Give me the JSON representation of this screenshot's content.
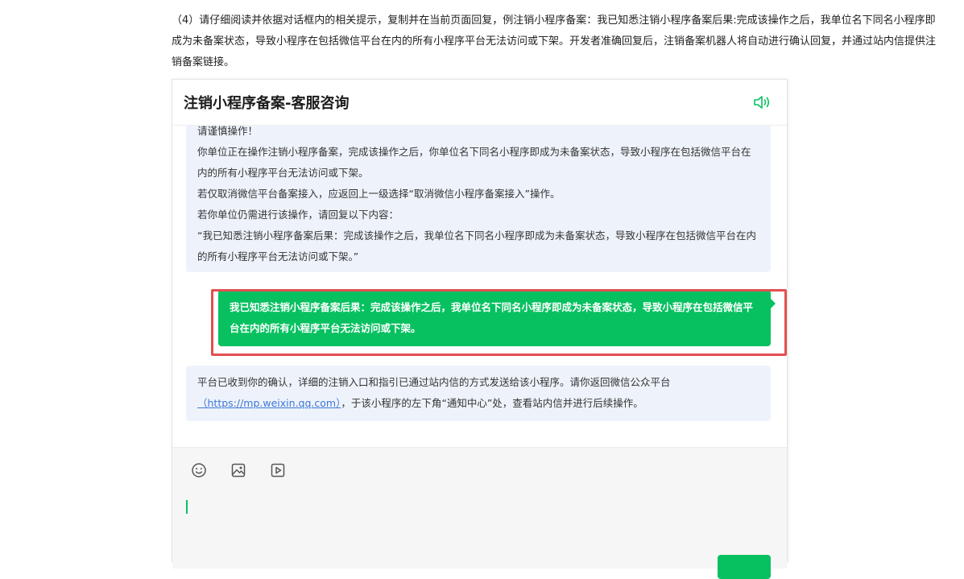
{
  "intro": {
    "text": "（4）请仔细阅读并依据对话框内的相关提示，复制并在当前页面回复，例注销小程序备案：我已知悉注销小程序备案后果:完成该操作之后，我单位名下同名小程序即成为未备案状态，导致小程序在包括微信平台在内的所有小程序平台无法访问或下架。开发者准确回复后，注销备案机器人将自动进行确认回复，并通过站内信提供注销备案链接。"
  },
  "chat": {
    "title": "注销小程序备案-客服咨询",
    "messages": {
      "system_notice": {
        "lines": [
          "请谨慎操作！",
          "你单位正在操作注销小程序备案，完成该操作之后，你单位名下同名小程序即成为未备案状态，导致小程序在包括微信平台在内的所有小程序平台无法访问或下架。",
          "若仅取消微信平台备案接入，应返回上一级选择“取消微信小程序备案接入”操作。",
          "若你单位仍需进行该操作，请回复以下内容：",
          "“我已知悉注销小程序备案后果：完成该操作之后，我单位名下同名小程序即成为未备案状态，导致小程序在包括微信平台在内的所有小程序平台无法访问或下架。”"
        ]
      },
      "user_reply": "我已知悉注销小程序备案后果：完成该操作之后，我单位名下同名小程序即成为未备案状态，导致小程序在包括微信平台在内的所有小程序平台无法访问或下架。",
      "system_confirm": {
        "before_link": "平台已收到你的确认，详细的注销入口和指引已通过站内信的方式发送给该小程序。请你返回微信公众平台",
        "link": "（https://mp.weixin.qq.com）",
        "after_link": "，于该小程序的左下角“通知中心”处，查看站内信并进行后续操作。"
      }
    },
    "toolbar": {
      "icons": [
        "emoji-icon",
        "image-icon",
        "video-icon"
      ]
    },
    "input": {
      "value": ""
    }
  },
  "colors": {
    "accent": "#07c160",
    "highlight": "#e34f50",
    "system_bubble": "#eef3fb",
    "link": "#3d77d6"
  }
}
